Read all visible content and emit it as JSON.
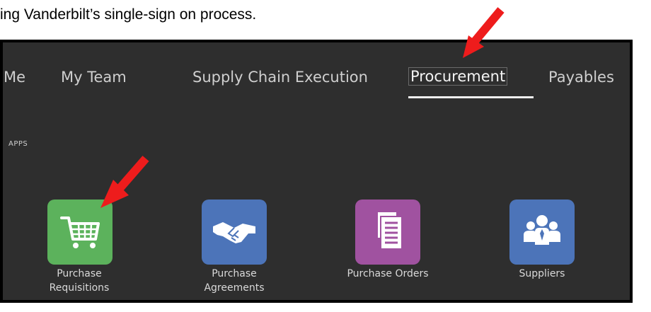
{
  "intro": {
    "text": "ing Vanderbilt’s single-sign on process."
  },
  "nav": {
    "tabs": [
      {
        "label": "Me",
        "active": false
      },
      {
        "label": "My Team",
        "active": false
      },
      {
        "label": "Supply Chain Execution",
        "active": false
      },
      {
        "label": "Procurement",
        "active": true
      },
      {
        "label": "Payables",
        "active": false
      }
    ]
  },
  "apps": {
    "section_label": "APPS",
    "tiles": [
      {
        "label_line1": "Purchase",
        "label_line2": "Requisitions",
        "icon": "shopping-cart-icon",
        "color": "#5cb25c"
      },
      {
        "label_line1": "Purchase",
        "label_line2": "Agreements",
        "icon": "handshake-icon",
        "color": "#4c74b9"
      },
      {
        "label_line1": "Purchase Orders",
        "label_line2": "",
        "icon": "documents-icon",
        "color": "#a052a0"
      },
      {
        "label_line1": "Suppliers",
        "label_line2": "",
        "icon": "people-group-icon",
        "color": "#4c74b9"
      }
    ]
  },
  "annotations": {
    "arrow_color": "#ee1c1c"
  }
}
